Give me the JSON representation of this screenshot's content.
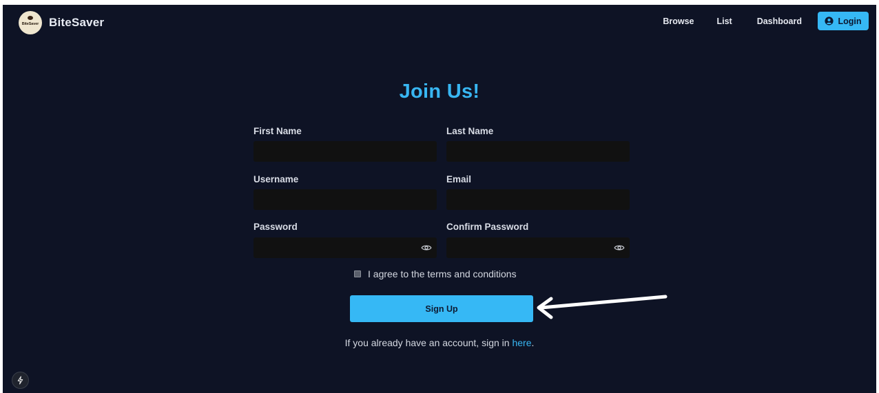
{
  "brand": {
    "name": "BiteSaver",
    "logo_text": "BiteSaver"
  },
  "nav": {
    "browse": "Browse",
    "list": "List",
    "dashboard": "Dashboard",
    "login": "Login"
  },
  "form": {
    "title": "Join Us!",
    "first_name_label": "First Name",
    "last_name_label": "Last Name",
    "username_label": "Username",
    "email_label": "Email",
    "password_label": "Password",
    "confirm_password_label": "Confirm Password",
    "first_name_value": "",
    "last_name_value": "",
    "username_value": "",
    "email_value": "",
    "password_value": "",
    "confirm_password_value": "",
    "agree_text": "I agree to the terms and conditions",
    "signup_label": "Sign Up",
    "signin_prefix": "If you already have an account, sign in ",
    "signin_link": "here",
    "signin_suffix": "."
  },
  "colors": {
    "background": "#0e1325",
    "accent": "#36b8f5",
    "input": "#111111"
  },
  "icons": [
    "user-circle-icon",
    "eye-icon",
    "arrow-icon",
    "bolt-icon"
  ]
}
